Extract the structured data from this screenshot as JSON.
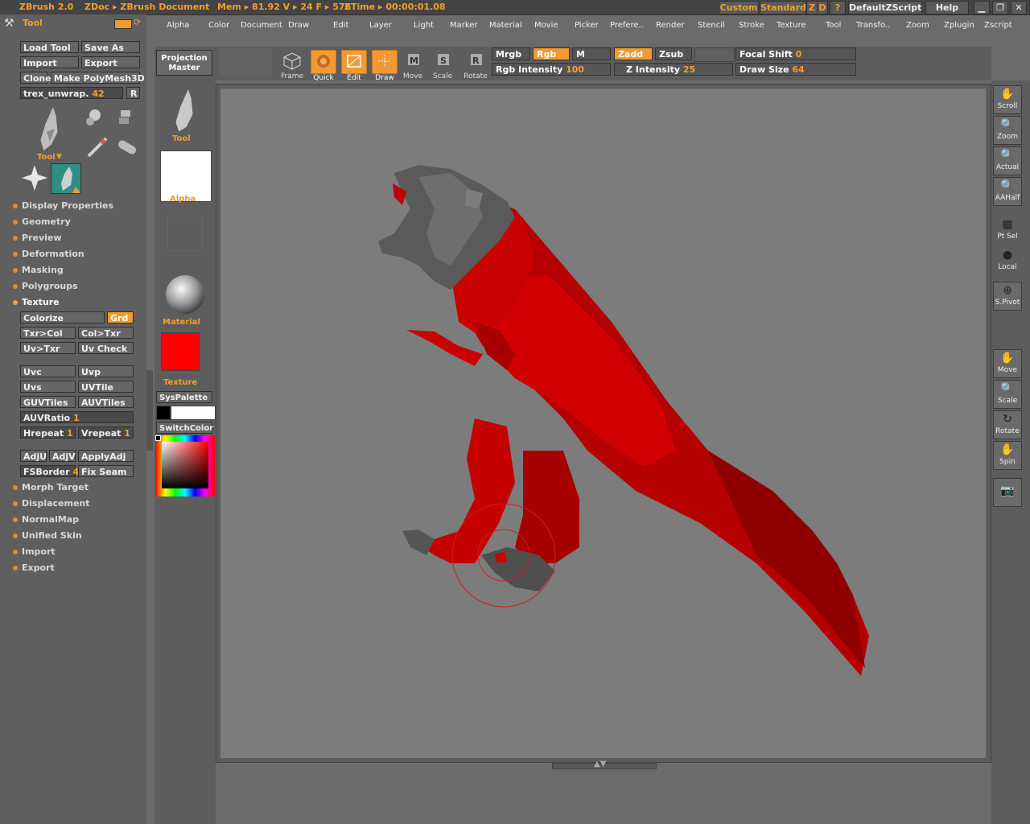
{
  "titlebar": {
    "app": "ZBrush 2.0",
    "doc": "ZDoc ▸ ZBrush Document",
    "mem": "Mem ▸ 81.92  V ▸ 24  F ▸ 576",
    "ztime": "ZTime ▸ 00:00:01.08",
    "custom": "Custom",
    "standard": "Standard",
    "z": "Z",
    "d": "D",
    "q": "?",
    "script": "DefaultZScript",
    "help": "Help"
  },
  "menus": [
    "Alpha",
    "Color",
    "Document",
    "Draw",
    "Edit",
    "Layer",
    "Light",
    "Marker",
    "Material",
    "Movie",
    "Picker",
    "Prefere..",
    "Render",
    "Stencil",
    "Stroke",
    "Texture",
    "Tool",
    "Transfo..",
    "Zoom",
    "Zplugin",
    "Zscript"
  ],
  "left": {
    "title": "Tool",
    "load_tool": "Load Tool",
    "save_as": "Save As",
    "import": "Import",
    "export": "Export",
    "clone": "Clone",
    "make_polymesh": "Make PolyMesh3D",
    "tool_name": "trex_unwrap.",
    "tool_num": "42",
    "r": "R",
    "tool_label": "Tool",
    "sections": [
      "Display Properties",
      "Geometry",
      "Preview",
      "Deformation",
      "Masking",
      "Polygroups",
      "Texture"
    ],
    "colorize": "Colorize",
    "grd": "Grd",
    "txr_col": "Txr>Col",
    "col_txr": "Col>Txr",
    "uv_txr": "Uv>Txr",
    "uv_check": "Uv Check",
    "uvc": "Uvc",
    "uvp": "Uvp",
    "uvs": "Uvs",
    "uvtile": "UVTile",
    "guvtiles": "GUVTiles",
    "auvtiles": "AUVTiles",
    "auvratio": "AUVRatio",
    "auvratio_v": "1",
    "hrepeat": "Hrepeat",
    "hrepeat_v": "1",
    "vrepeat": "Vrepeat",
    "vrepeat_v": "1",
    "adju": "AdjU",
    "adjv": "AdjV",
    "applyadj": "ApplyAdj",
    "fsborder": "FSBorder",
    "fsborder_v": "4",
    "fix_seam": "Fix Seam",
    "sections2": [
      "Morph Target",
      "Displacement",
      "NormalMap",
      "Unified Skin",
      "Import",
      "Export"
    ]
  },
  "mid": {
    "projection": "Projection",
    "master": "Master",
    "tool": "Tool",
    "alpha": "Alpha",
    "material": "Material",
    "texture": "Texture",
    "syspalette": "SysPalette",
    "switchcolor": "SwitchColor"
  },
  "toolbar": {
    "frame": "Frame",
    "quick": "Quick",
    "edit": "Edit",
    "draw": "Draw",
    "move": "Move",
    "scale": "Scale",
    "rotate": "Rotate",
    "mrgb": "Mrgb",
    "rgb": "Rgb",
    "m": "M",
    "zadd": "Zadd",
    "zsub": "Zsub",
    "rgb_intensity": "Rgb Intensity",
    "rgb_intensity_v": "100",
    "z_intensity": "Z Intensity",
    "z_intensity_v": "25",
    "focal_shift": "Focal Shift",
    "focal_shift_v": "0",
    "draw_size": "Draw Size",
    "draw_size_v": "64"
  },
  "right": [
    "Scroll",
    "Zoom",
    "Actual",
    "AAHalf",
    "Pt Sel",
    "Local",
    "S.Pivot",
    "Move",
    "Scale",
    "Rotate",
    "Spin"
  ],
  "colors": {
    "accent": "#f19a33",
    "model_red": "#c40000",
    "model_gray": "#555555",
    "canvas": "#7c7c7c",
    "main_color": "#ff0000"
  }
}
